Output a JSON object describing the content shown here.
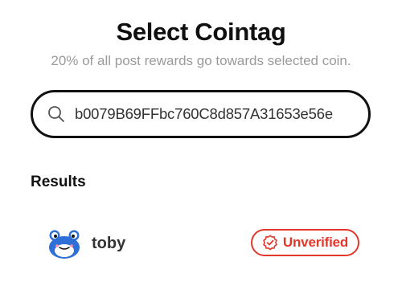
{
  "header": {
    "title": "Select Cointag",
    "subtitle": "20% of all post rewards go towards selected coin."
  },
  "search": {
    "icon": "search-icon",
    "value": "b0079B69FFbc760C8d857A31653e56e",
    "placeholder": ""
  },
  "results": {
    "heading": "Results",
    "items": [
      {
        "name": "toby",
        "avatar_icon": "toby-frog-avatar",
        "status_label": "Unverified",
        "status_icon": "unverified-badge-icon",
        "status_color": "#e2372b"
      }
    ]
  },
  "colors": {
    "text": "#111111",
    "subtitle": "#9a9a9a",
    "unverified": "#e2372b",
    "avatar_blue": "#2f6fd8"
  }
}
